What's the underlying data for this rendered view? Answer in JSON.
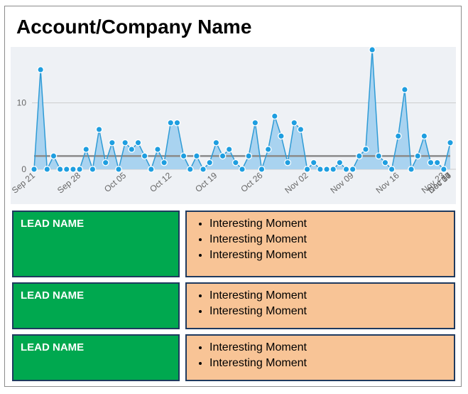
{
  "title": "Account/Company Name",
  "chart_data": {
    "type": "area",
    "y_ticks": [
      0,
      10
    ],
    "ylim": [
      0,
      18
    ],
    "x_tick_labels": [
      "Sep 21",
      "Sep 28",
      "Oct 05",
      "Oct 12",
      "Oct 19",
      "Oct 26",
      "Nov 02",
      "Nov 09",
      "Nov 16",
      "Nov 23",
      "Nov 30",
      "Dec 07",
      "Dec 14"
    ],
    "values": [
      0,
      15,
      0,
      2,
      0,
      0,
      0,
      0,
      3,
      0,
      6,
      1,
      4,
      0,
      4,
      3,
      4,
      2,
      0,
      3,
      1,
      7,
      7,
      2,
      0,
      2,
      0,
      1,
      4,
      2,
      3,
      1,
      0,
      2,
      7,
      0,
      3,
      8,
      5,
      1,
      7,
      6,
      0,
      1,
      0,
      0,
      0,
      1,
      0,
      0,
      2,
      3,
      18,
      2,
      1,
      0,
      5,
      12,
      0,
      2,
      5,
      1,
      1,
      0,
      4
    ],
    "reference_line": 2,
    "colors": {
      "area": "#a9d3f0",
      "line": "#2e9bd6",
      "marker": "#1e9ee0",
      "reference": "#8a8a8a",
      "grid": "#cccccc"
    }
  },
  "leads": [
    {
      "name": "LEAD NAME",
      "moments": [
        "Interesting Moment",
        "Interesting Moment",
        "Interesting Moment"
      ]
    },
    {
      "name": "LEAD NAME",
      "moments": [
        "Interesting Moment",
        "Interesting Moment"
      ]
    },
    {
      "name": "LEAD NAME",
      "moments": [
        "Interesting Moment",
        "Interesting Moment"
      ]
    }
  ]
}
